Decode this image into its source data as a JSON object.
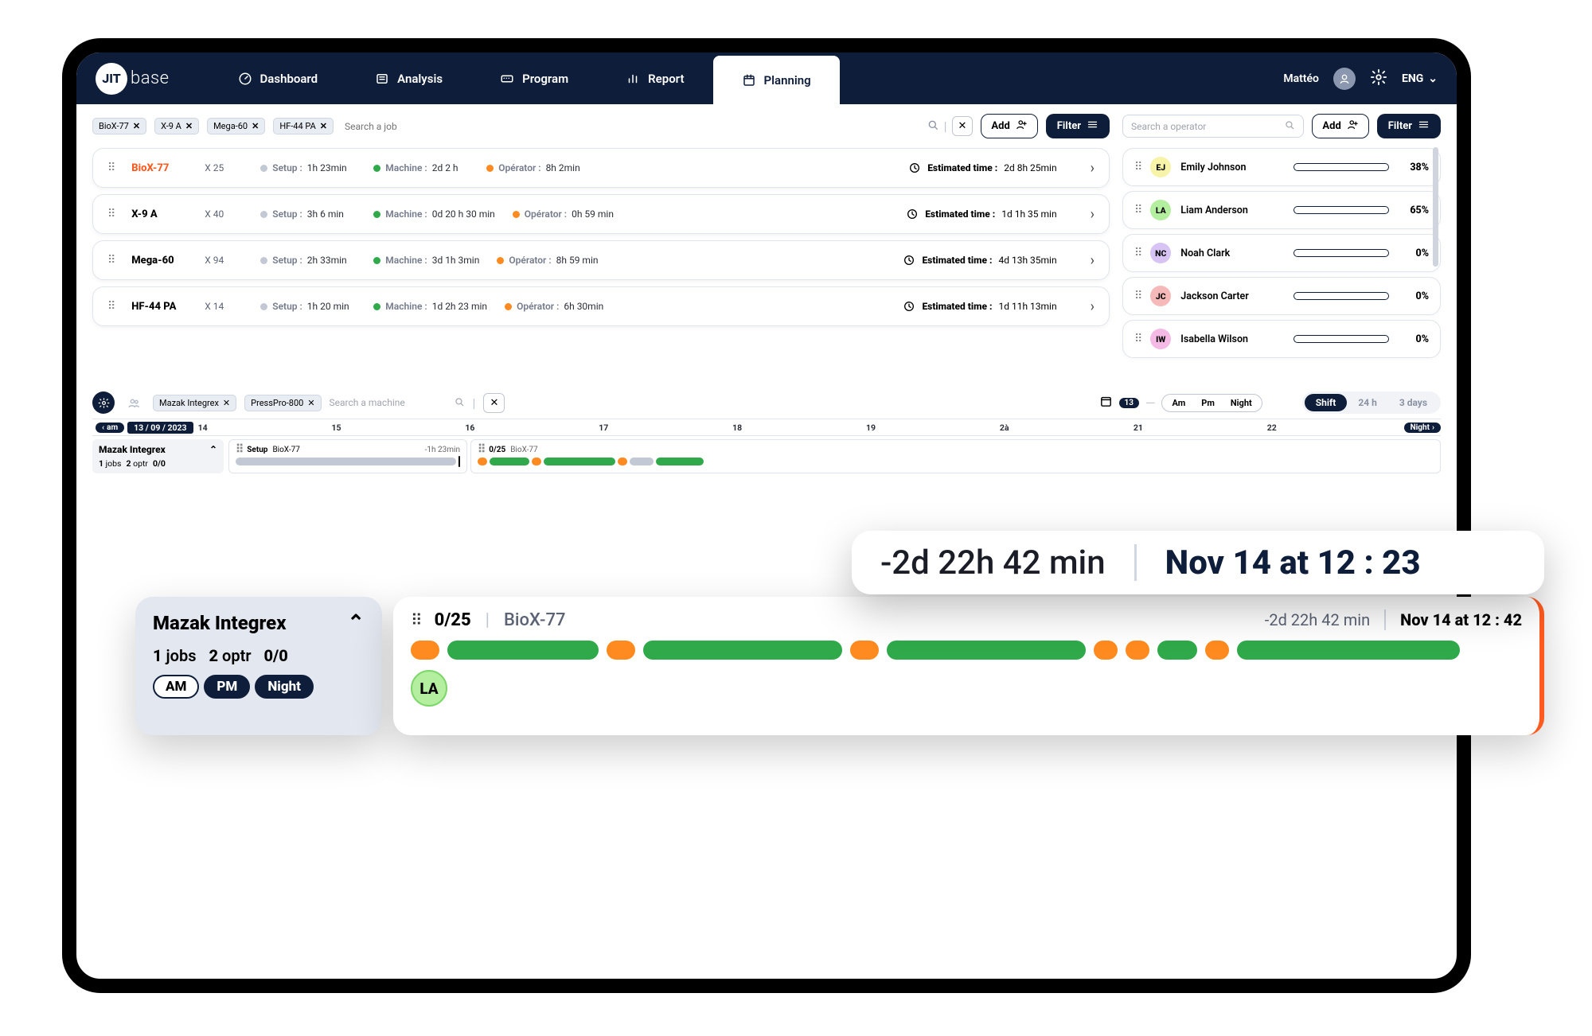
{
  "brand": {
    "mark": "JIT",
    "text": "base"
  },
  "nav": {
    "items": [
      {
        "label": "Dashboard"
      },
      {
        "label": "Analysis"
      },
      {
        "label": "Program"
      },
      {
        "label": "Report"
      },
      {
        "label": "Planning"
      }
    ]
  },
  "user": {
    "name": "Mattéo",
    "lang": "ENG"
  },
  "jobs_toolbar": {
    "chips": [
      "BioX-77",
      "X-9 A",
      "Mega-60",
      "HF-44 PA"
    ],
    "search_placeholder": "Search a job",
    "add_label": "Add",
    "filter_label": "Filter"
  },
  "jobs": [
    {
      "name": "BioX-77",
      "alert": true,
      "qty": "X 25",
      "setup": "1h 23min",
      "machine": "2d 2 h",
      "operator": "8h 2min",
      "estimated": "2d 8h 25min"
    },
    {
      "name": "X-9 A",
      "alert": false,
      "qty": "X 40",
      "setup": "3h 6 min",
      "machine": "0d 20 h 30 min",
      "operator": "0h 59 min",
      "estimated": "1d 1h 35 min"
    },
    {
      "name": "Mega-60",
      "alert": false,
      "qty": "X 94",
      "setup": "2h  33min",
      "machine": "3d 1h 3min",
      "operator": "8h 59 min",
      "estimated": "4d 13h 35min"
    },
    {
      "name": "HF-44 PA",
      "alert": false,
      "qty": "X 14",
      "setup": "1h 20 min",
      "machine": "1d 2h 23 min",
      "operator": "6h 30min",
      "estimated": "1d 11h 13min"
    }
  ],
  "job_labels": {
    "setup": "Setup :",
    "machine": "Machine :",
    "operator": "Opérator :",
    "estimated": "Estimated time :"
  },
  "ops_toolbar": {
    "search_placeholder": "Search a operator",
    "add_label": "Add",
    "filter_label": "Filter"
  },
  "operators": [
    {
      "initials": "EJ",
      "name": "Emily Johnson",
      "pct": 38,
      "color": "#f7f3a8"
    },
    {
      "initials": "LA",
      "name": "Liam Anderson",
      "pct": 65,
      "color": "#b4ee9f"
    },
    {
      "initials": "NC",
      "name": "Noah Clark",
      "pct": 0,
      "color": "#d7c4f5"
    },
    {
      "initials": "JC",
      "name": "Jackson Carter",
      "pct": 0,
      "color": "#f5b9b9"
    },
    {
      "initials": "IW",
      "name": "Isabella Wilson",
      "pct": 0,
      "color": "#f5b9e5"
    }
  ],
  "timeline": {
    "machine_chips": [
      "Mazak Integrex",
      "PressPro-800"
    ],
    "search_placeholder": "Search a machine",
    "date_badge": "13",
    "shift_pills": [
      "Am",
      "Pm",
      "Night"
    ],
    "view_options": [
      "Shift",
      "24 h",
      "3 days"
    ],
    "ruler": {
      "left_cap": "am",
      "date": "13 / 09 / 2023",
      "ticks": [
        "14",
        "15",
        "16",
        "17",
        "18",
        "19",
        "2à",
        "21",
        "22"
      ],
      "right_cap": "Night"
    },
    "side": {
      "title": "Mazak Integrex",
      "jobs_count": "1",
      "jobs_label": "jobs",
      "optr_count": "2",
      "optr_label": "optr",
      "ratio": "0/0"
    },
    "lane_setup": {
      "label": "Setup",
      "job": "BioX-77",
      "delta": "-1h 23min"
    },
    "lane_run": {
      "count": "0/25",
      "job": "BioX-77"
    }
  },
  "callout1": {
    "delta": "-2d 22h  42 min",
    "eta": "Nov 14 at 12 : 23"
  },
  "callout2": {
    "side": {
      "title": "Mazak Integrex",
      "jobs_count": "1",
      "jobs_label": "jobs",
      "optr_count": "2",
      "optr_label": "optr",
      "ratio": "0/0",
      "pills": [
        "AM",
        "PM",
        "Night"
      ]
    },
    "main": {
      "count": "0/25",
      "job": "BioX-77",
      "delta": "-2d 22h  42 min",
      "eta": "Nov 14 at 12 : 42",
      "avatar": "LA"
    }
  }
}
